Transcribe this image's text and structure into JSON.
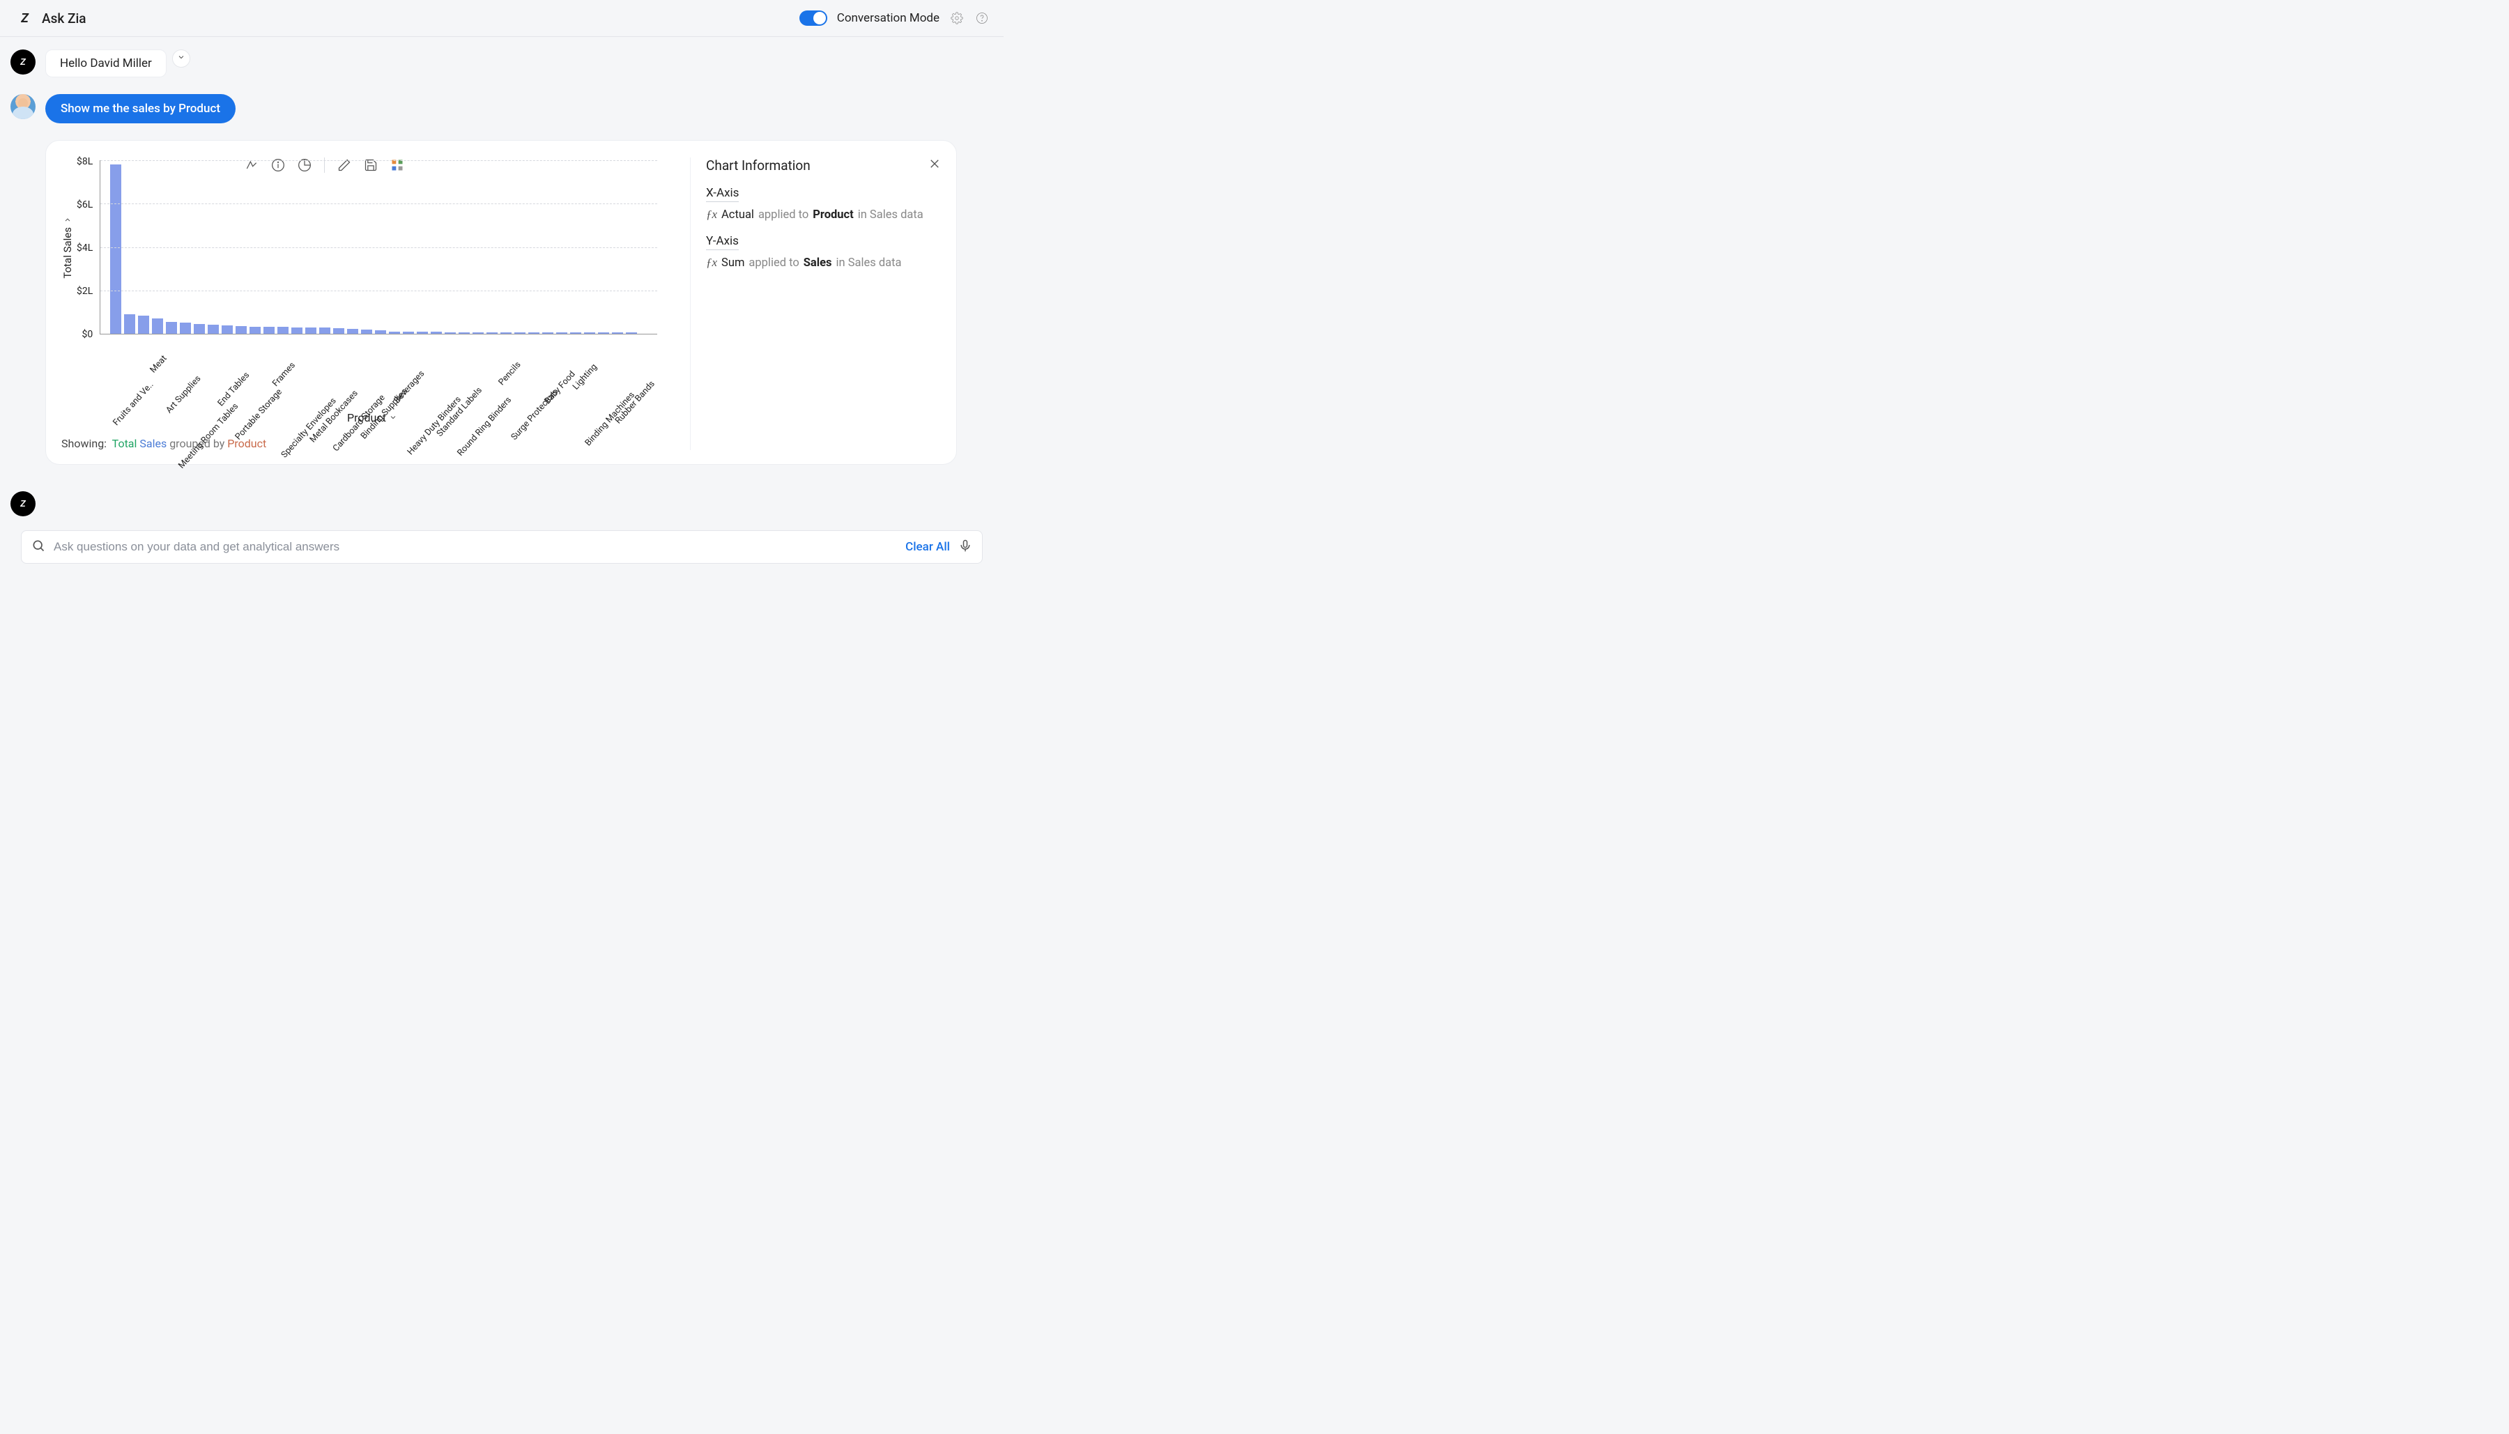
{
  "header": {
    "title": "Ask Zia",
    "conversation_mode_label": "Conversation Mode"
  },
  "conversation": {
    "greeting": "Hello David Miller",
    "user_query": "Show me the sales by Product"
  },
  "chart_data": {
    "type": "bar",
    "ylabel": "Total Sales",
    "xlabel": "Product",
    "ylim": [
      0,
      8
    ],
    "y_unit_suffix": "L",
    "y_ticks": [
      "$8L",
      "$6L",
      "$4L",
      "$2L",
      "$0"
    ],
    "categories": [
      "Fruits and Ve..",
      "Meat",
      "Art Supplies",
      "Meeting Room Tables",
      "End Tables",
      "Portable Storage",
      "Frames",
      "Specialty Envelopes",
      "Metal Bookcases",
      "Cardboard Storage",
      "Binding Supplies",
      "Beverages",
      "Heavy Duty Binders",
      "Standard Labels",
      "Round Ring Binders",
      "Pencils",
      "Surge Protectors",
      "Baby Food",
      "Lighting",
      "Binding Machines",
      "Rubber Bands"
    ],
    "values": [
      7.8,
      0.9,
      0.85,
      0.7,
      0.55,
      0.5,
      0.45,
      0.42,
      0.38,
      0.35,
      0.33,
      0.32,
      0.31,
      0.3,
      0.3,
      0.29,
      0.27,
      0.22,
      0.2,
      0.15,
      0.1,
      0.09,
      0.085,
      0.083,
      0.08,
      0.078,
      0.075,
      0.073,
      0.07,
      0.065,
      0.06,
      0.058,
      0.055,
      0.05,
      0.045,
      0.04,
      0.035,
      0.032
    ]
  },
  "showing": {
    "prefix": "Showing:",
    "total": "Total",
    "sales": "Sales",
    "grouped": "grouped by",
    "product": "Product"
  },
  "info_panel": {
    "title": "Chart Information",
    "x_heading": "X-Axis",
    "x_func": "Actual",
    "x_applied": "applied to",
    "x_field": "Product",
    "x_in": "in Sales data",
    "y_heading": "Y-Axis",
    "y_func": "Sum",
    "y_applied": "applied to",
    "y_field": "Sales",
    "y_in": "in Sales data"
  },
  "input": {
    "placeholder": "Ask questions on your data and get analytical answers",
    "clear_all": "Clear All"
  }
}
